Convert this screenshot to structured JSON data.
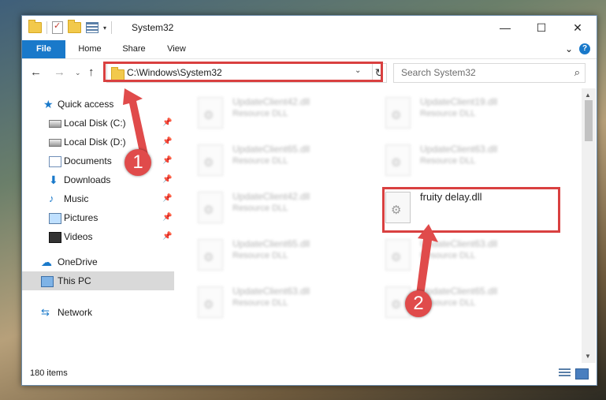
{
  "window": {
    "title": "System32"
  },
  "window_controls": {
    "minimize": "—",
    "maximize": "☐",
    "close": "✕"
  },
  "ribbon": {
    "tabs": [
      "File",
      "Home",
      "Share",
      "View"
    ],
    "expand_glyph": "⌄",
    "help_glyph": "?"
  },
  "nav": {
    "back": "←",
    "forward": "→",
    "recent": "⌄",
    "up": "↑",
    "address": "C:\\Windows\\System32",
    "address_dropdown": "⌄",
    "refresh": "↻",
    "search_placeholder": "Search System32",
    "search_glyph": "⌕"
  },
  "sidebar": {
    "pin_glyph": "📌",
    "items": [
      {
        "label": "Quick access",
        "icon": "star-icon",
        "glyph": "★"
      },
      {
        "label": "Local Disk (C:)",
        "icon": "drive-icon",
        "pinned": true
      },
      {
        "label": "Local Disk (D:)",
        "icon": "drive-icon",
        "pinned": true
      },
      {
        "label": "Documents",
        "icon": "documents-icon",
        "pinned": true
      },
      {
        "label": "Downloads",
        "icon": "download-icon",
        "glyph": "⬇",
        "pinned": true
      },
      {
        "label": "Music",
        "icon": "music-icon",
        "glyph": "♪",
        "pinned": true
      },
      {
        "label": "Pictures",
        "icon": "pictures-icon",
        "pinned": true
      },
      {
        "label": "Videos",
        "icon": "videos-icon",
        "pinned": true
      },
      {
        "label": "OneDrive",
        "icon": "cloud-icon",
        "glyph": "☁"
      },
      {
        "label": "This PC",
        "icon": "computer-icon",
        "selected": true
      },
      {
        "label": "Network",
        "icon": "network-icon",
        "glyph": "⇆"
      }
    ]
  },
  "files": [
    {
      "name": "UpdateClient42.dll",
      "type": "Resource DLL"
    },
    {
      "name": "UpdateClient19.dll",
      "type": "Resource DLL"
    },
    {
      "name": "UpdateClient65.dll",
      "type": "Resource DLL"
    },
    {
      "name": "UpdateClient63.dll",
      "type": "Resource DLL"
    },
    {
      "name": "UpdateClient42.dll",
      "type": "Resource DLL"
    },
    {
      "name": "fruity delay.dll",
      "type": ""
    },
    {
      "name": "UpdateClient65.dll",
      "type": "Resource DLL"
    },
    {
      "name": "UpdateClient63.dll",
      "type": "Resource DLL"
    },
    {
      "name": "UpdateClient63.dll",
      "type": "Resource DLL"
    },
    {
      "name": "UpdateClient65.dll",
      "type": "Resource DLL"
    }
  ],
  "scrollbar": {
    "up": "▲",
    "down": "▼"
  },
  "status": {
    "item_count": "180 items"
  },
  "annotations": {
    "step1": "1",
    "step2": "2",
    "color": "#e04b4b"
  }
}
